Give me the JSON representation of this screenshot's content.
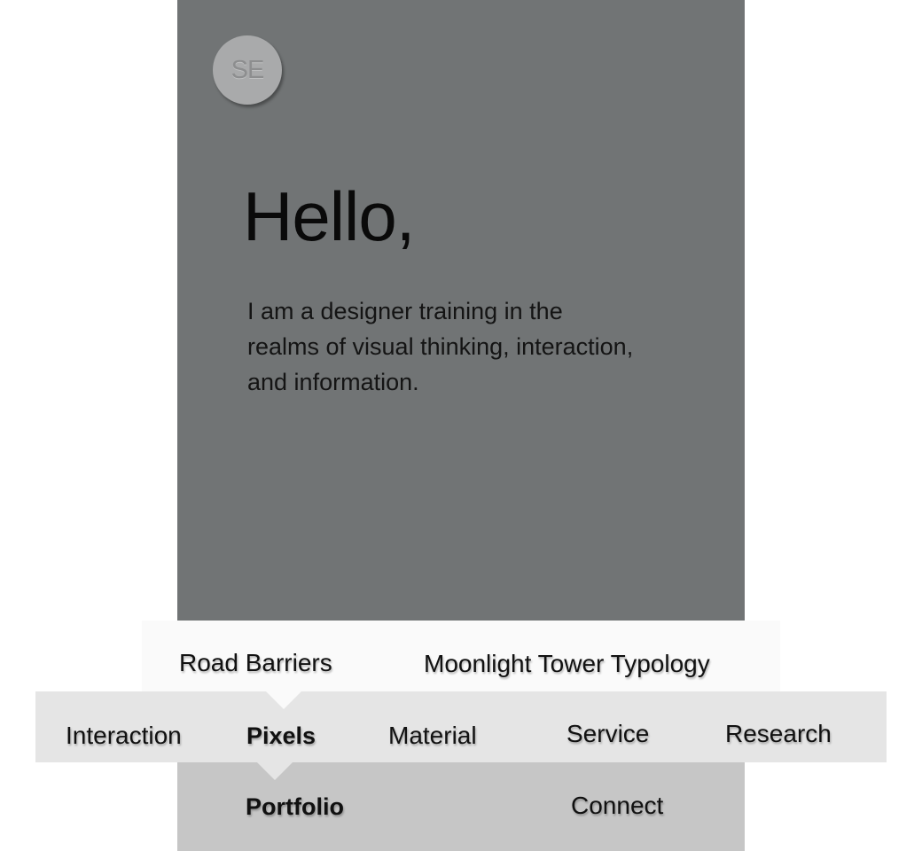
{
  "hero": {
    "avatar_initials": "SE",
    "greeting": "Hello,",
    "intro": "I am a designer training in the realms of visual thinking, interaction, and information."
  },
  "nav": {
    "projects": [
      "Road Barriers",
      "Moonlight Tower Typology"
    ],
    "categories": [
      "Interaction",
      "Pixels",
      "Material",
      "Service",
      "Research"
    ],
    "active_category": "Pixels",
    "main": [
      "Portfolio",
      "Connect"
    ],
    "active_main": "Portfolio"
  },
  "colors": {
    "hero_bg": "#717475",
    "avatar_bg": "#a9aaab",
    "projects_bg": "#fafafa",
    "categories_bg": "#e5e5e5",
    "main_bg": "#c6c6c6",
    "text": "#111111"
  }
}
